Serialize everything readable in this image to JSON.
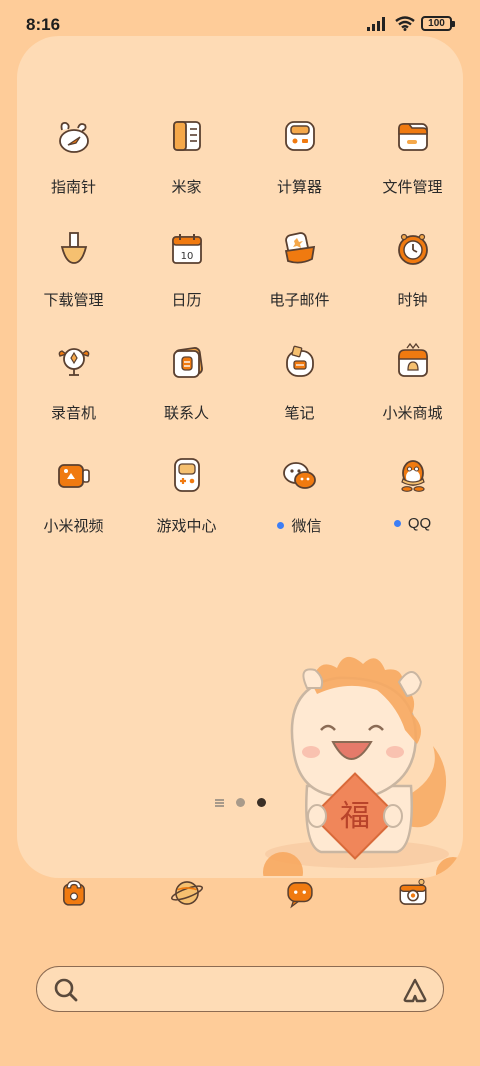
{
  "status_bar": {
    "time": "8:16",
    "battery": "100"
  },
  "folder": {
    "apps": [
      {
        "label": "指南针",
        "icon": "compass-icon",
        "dot": false
      },
      {
        "label": "米家",
        "icon": "mijia-icon",
        "dot": false
      },
      {
        "label": "计算器",
        "icon": "calculator-icon",
        "dot": false
      },
      {
        "label": "文件管理",
        "icon": "file-manager-icon",
        "dot": false
      },
      {
        "label": "下载管理",
        "icon": "download-icon",
        "dot": false
      },
      {
        "label": "日历",
        "icon": "calendar-icon",
        "dot": false,
        "date": "10"
      },
      {
        "label": "电子邮件",
        "icon": "email-icon",
        "dot": false
      },
      {
        "label": "时钟",
        "icon": "clock-icon",
        "dot": false
      },
      {
        "label": "录音机",
        "icon": "recorder-icon",
        "dot": false
      },
      {
        "label": "联系人",
        "icon": "contacts-icon",
        "dot": false
      },
      {
        "label": "笔记",
        "icon": "notes-icon",
        "dot": false
      },
      {
        "label": "小米商城",
        "icon": "mi-store-icon",
        "dot": false
      },
      {
        "label": "小米视频",
        "icon": "mi-video-icon",
        "dot": false
      },
      {
        "label": "游戏中心",
        "icon": "game-center-icon",
        "dot": false
      },
      {
        "label": "微信",
        "icon": "wechat-icon",
        "dot": true
      },
      {
        "label": "QQ",
        "icon": "qq-icon",
        "dot": true
      }
    ],
    "mascot_text": "福"
  },
  "dock": [
    {
      "icon": "phone-icon"
    },
    {
      "icon": "browser-icon"
    },
    {
      "icon": "messages-icon"
    },
    {
      "icon": "camera-icon"
    }
  ],
  "colors": {
    "background": "#FECC99",
    "panel": "#FEDBB5",
    "accent": "#F07A10",
    "ink": "#2a2a2a"
  }
}
